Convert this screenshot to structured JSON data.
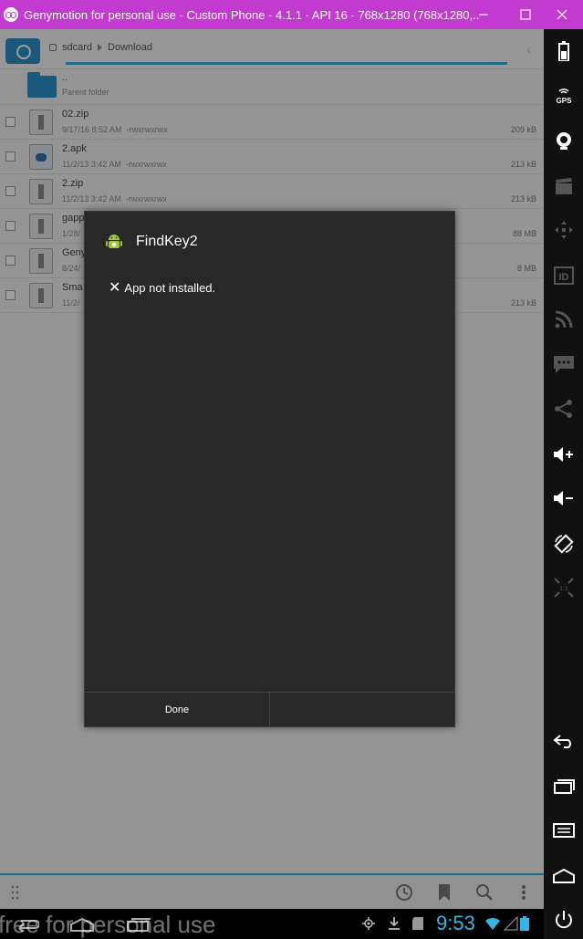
{
  "window": {
    "title": "Genymotion for personal use - Custom Phone - 4.1.1 - API 16 - 768x1280 (768x1280,...",
    "title_bg": "#c23ad0"
  },
  "file_manager": {
    "breadcrumb": [
      "sdcard",
      "Download"
    ],
    "parent": {
      "dots": "..",
      "label": "Parent folder"
    },
    "files": [
      {
        "name": "02.zip",
        "date": "9/17/16 8:52 AM",
        "perms": "-rwxrwxrwx",
        "size": "209 kB",
        "icon": "zip-file-icon"
      },
      {
        "name": "2.apk",
        "date": "11/2/13 3:42 AM",
        "perms": "-rwxrwxrwx",
        "size": "213 kB",
        "icon": "apk-file-icon"
      },
      {
        "name": "2.zip",
        "date": "11/2/13 3:42 AM",
        "perms": "-rwxrwxrwx",
        "size": "213 kB",
        "icon": "zip-file-icon"
      },
      {
        "name": "gapp",
        "date": "1/28/",
        "perms": "",
        "size": "88 MB",
        "icon": "zip-file-icon"
      },
      {
        "name": "Geny",
        "date": "8/24/",
        "perms": "",
        "size": "8 MB",
        "icon": "zip-file-icon"
      },
      {
        "name": "Sma",
        "date": "11/2/",
        "perms": "",
        "size": "213 kB",
        "icon": "zip-file-icon"
      }
    ]
  },
  "dialog": {
    "title": "FindKey2",
    "message": "App not installed.",
    "buttons": [
      "Done",
      ""
    ]
  },
  "status_bar": {
    "time": "9:53",
    "watermark": "free for personal use"
  },
  "colors": {
    "accent": "#33b5e5",
    "folder": "#2e8fc7",
    "dialog_bg": "#282828"
  }
}
